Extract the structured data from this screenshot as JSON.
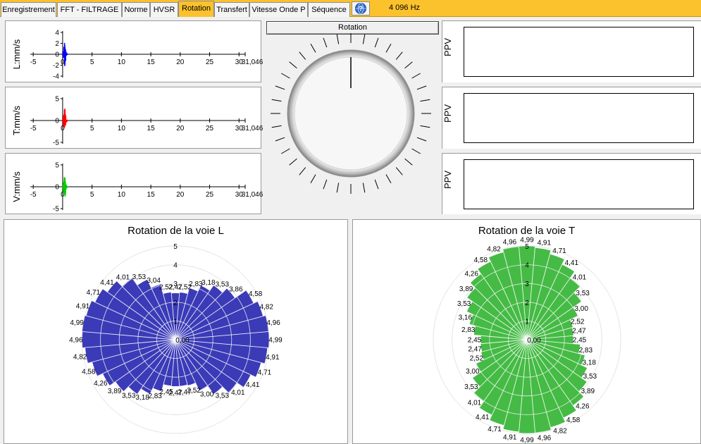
{
  "tabs": [
    {
      "label": "Enregistrement",
      "active": false
    },
    {
      "label": "FFT - FILTRAGE",
      "active": false
    },
    {
      "label": "Norme",
      "active": false
    },
    {
      "label": "HVSR",
      "active": false
    },
    {
      "label": "Rotation",
      "active": true
    },
    {
      "label": "Transfert",
      "active": false
    },
    {
      "label": "Vitesse Onde P",
      "active": false
    },
    {
      "label": "Séquence",
      "active": false
    }
  ],
  "help_icon": "help-globe-icon",
  "frequency": "4 096 Hz",
  "rotation_button": "Rotation",
  "ppv_label": "PPV",
  "colors": {
    "accent": "#fcc22d",
    "L": "#0000ff",
    "T": "#ff0000",
    "V": "#00cc00",
    "polarL": "#3b3bb8",
    "polarT": "#45bb45"
  },
  "waveforms": [
    {
      "ylabel": "L:mm/s",
      "color": "#0000ff",
      "yticks": [
        "4",
        "2",
        "0",
        "-2",
        "-4"
      ],
      "xticks": [
        "-5",
        "0",
        "5",
        "10",
        "15",
        "20",
        "25",
        "30"
      ],
      "xend": "31,046"
    },
    {
      "ylabel": "T:mm/s",
      "color": "#ff0000",
      "yticks": [
        "5",
        "0",
        "-5"
      ],
      "xticks": [
        "-5",
        "0",
        "5",
        "10",
        "15",
        "20",
        "25",
        "30"
      ],
      "xend": "31,046"
    },
    {
      "ylabel": "V:mm/s",
      "color": "#00cc00",
      "yticks": [
        "5",
        "0",
        "-5"
      ],
      "xticks": [
        "-5",
        "0",
        "5",
        "10",
        "15",
        "20",
        "25",
        "30"
      ],
      "xend": "31,046"
    }
  ],
  "chart_data": [
    {
      "type": "polar",
      "title": "Rotation de la voie L",
      "rlim": [
        0,
        5
      ],
      "rticks": [
        "1",
        "2",
        "3",
        "4",
        "5"
      ],
      "center_label": "0,00",
      "angles_deg": [
        0,
        10,
        20,
        30,
        40,
        50,
        60,
        70,
        80,
        90,
        100,
        110,
        120,
        130,
        140,
        150,
        160,
        170,
        180,
        190,
        200,
        210,
        220,
        230,
        240,
        250,
        260,
        270,
        280,
        290,
        300,
        310,
        320,
        330,
        340,
        350
      ],
      "values": [
        2.47,
        2.52,
        2.83,
        3.18,
        3.53,
        3.86,
        4.58,
        4.82,
        4.96,
        4.99,
        4.91,
        4.71,
        4.41,
        4.01,
        3.53,
        3.0,
        2.52,
        2.47,
        2.47,
        2.45,
        2.83,
        3.18,
        3.53,
        3.89,
        4.26,
        4.58,
        4.82,
        4.96,
        4.99,
        4.91,
        4.71,
        4.41,
        4.01,
        3.53,
        3.04,
        2.52
      ],
      "labels": [
        "2,47",
        "2,52",
        "2,83",
        "3,18",
        "3,53",
        "3,86",
        "4,58",
        "4,82",
        "4,96",
        "4,99",
        "4,91",
        "4,71",
        "4,41",
        "4,01",
        "3,53",
        "3,00",
        "2,52",
        "2,47",
        "2,47",
        "2,45",
        "2,83",
        "3,18",
        "3,53",
        "3,89",
        "4,26",
        "4,58",
        "4,82",
        "4,96",
        "4,99",
        "4,91",
        "4,71",
        "4,41",
        "4,01",
        "3,53",
        "3,04",
        "2,52"
      ],
      "color": "#3b3bb8"
    },
    {
      "type": "polar",
      "title": "Rotation de la voie T",
      "rlim": [
        0,
        5
      ],
      "rticks": [
        "1",
        "2",
        "3",
        "4",
        "5"
      ],
      "center_label": "0,00",
      "angles_deg": [
        0,
        10,
        20,
        30,
        40,
        50,
        60,
        70,
        80,
        90,
        100,
        110,
        120,
        130,
        140,
        150,
        160,
        170,
        180,
        190,
        200,
        210,
        220,
        230,
        240,
        250,
        260,
        270,
        280,
        290,
        300,
        310,
        320,
        330,
        340,
        350
      ],
      "values": [
        4.99,
        4.91,
        4.71,
        4.41,
        4.01,
        3.53,
        3.0,
        2.52,
        2.47,
        2.45,
        2.83,
        3.18,
        3.53,
        3.89,
        4.26,
        4.58,
        4.82,
        4.96,
        4.99,
        4.91,
        4.71,
        4.41,
        4.01,
        3.53,
        3.0,
        2.52,
        2.47,
        2.45,
        2.83,
        3.16,
        3.53,
        3.89,
        4.26,
        4.58,
        4.82,
        4.96
      ],
      "labels": [
        "4,99",
        "4,91",
        "4,71",
        "4,41",
        "4,01",
        "3,53",
        "3,00",
        "2,52",
        "2,47",
        "2,45",
        "2,83",
        "3,18",
        "3,53",
        "3,89",
        "4,26",
        "4,58",
        "4,82",
        "4,96",
        "4,99",
        "4,91",
        "4,71",
        "4,41",
        "4,01",
        "3,53",
        "3,00",
        "2,52",
        "2,47",
        "2,45",
        "2,83",
        "3,16",
        "3,53",
        "3,89",
        "4,26",
        "4,58",
        "4,82",
        "4,96"
      ],
      "color": "#45bb45"
    }
  ]
}
